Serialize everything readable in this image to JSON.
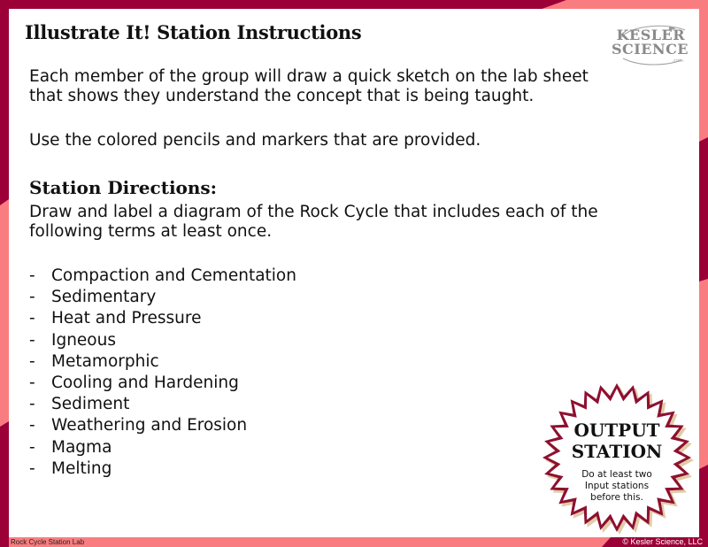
{
  "colors": {
    "maroon": "#9b0037",
    "pink": "#f97d80",
    "panel": "#ffffff"
  },
  "header": {
    "title": "Illustrate It! Station Instructions",
    "logo": {
      "line1": "KESLER",
      "line2": "SCIENCE",
      "suffix": ".com"
    }
  },
  "intro": {
    "paragraph1_line1": "Each member of the group will draw a quick sketch on the lab sheet",
    "paragraph1_line2": "that shows they understand the concept that is being taught.",
    "paragraph2": "Use the colored pencils and markers that are provided."
  },
  "directions": {
    "heading": "Station Directions:",
    "line1": "Draw and label a diagram of the Rock Cycle that includes each of the",
    "line2": "following terms at least once.",
    "bullet": "-",
    "terms": [
      "Compaction and Cementation",
      "Sedimentary",
      "Heat and Pressure",
      "Igneous",
      "Metamorphic",
      "Cooling and Hardening",
      "Sediment",
      "Weathering and Erosion",
      "Magma",
      "Melting"
    ]
  },
  "badge": {
    "title_line1": "OUTPUT",
    "title_line2": "STATION",
    "note_line1": "Do at least two",
    "note_line2": "Input stations",
    "note_line3": "before this."
  },
  "footer": {
    "left": "Rock Cycle Station Lab",
    "right": "© Kesler Science, LLC"
  }
}
